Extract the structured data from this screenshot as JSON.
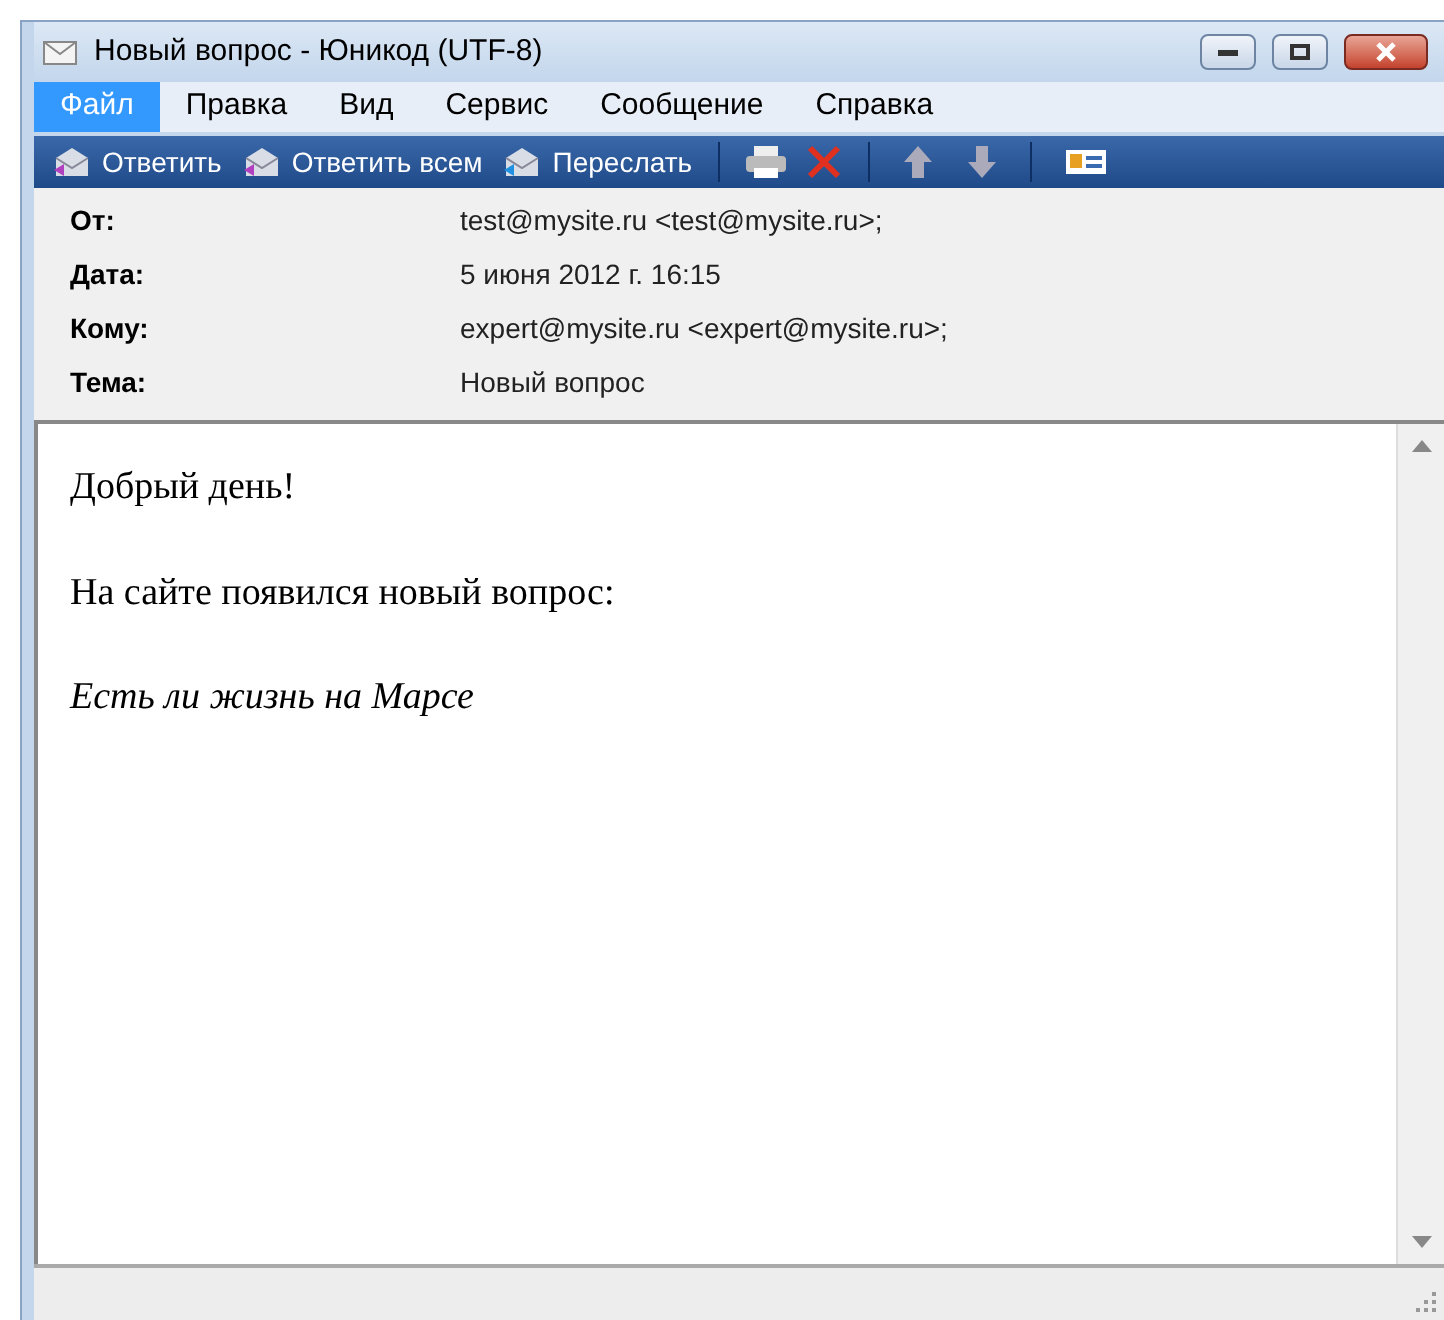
{
  "window": {
    "title": "Новый вопрос - Юникод (UTF-8)"
  },
  "menu": [
    {
      "label": "Файл",
      "selected": true
    },
    {
      "label": "Правка",
      "selected": false
    },
    {
      "label": "Вид",
      "selected": false
    },
    {
      "label": "Сервис",
      "selected": false
    },
    {
      "label": "Сообщение",
      "selected": false
    },
    {
      "label": "Справка",
      "selected": false
    }
  ],
  "toolbar": [
    "Ответить",
    "Ответить всем",
    "Переслать"
  ],
  "headers": [
    {
      "label": "От:",
      "value": "test@mysite.ru <test@mysite.ru>;"
    },
    {
      "label": "Дата:",
      "value": "5 июня 2012 г. 16:15"
    },
    {
      "label": "Кому:",
      "value": "expert@mysite.ru <expert@mysite.ru>;"
    },
    {
      "label": "Тема:",
      "value": "Новый вопрос"
    }
  ],
  "body": [
    {
      "text": "Добрый день!",
      "italic": false
    },
    {
      "text": "На сайте появился новый вопрос:",
      "italic": false
    },
    {
      "text": "Есть ли жизнь на Марсе",
      "italic": true
    }
  ]
}
